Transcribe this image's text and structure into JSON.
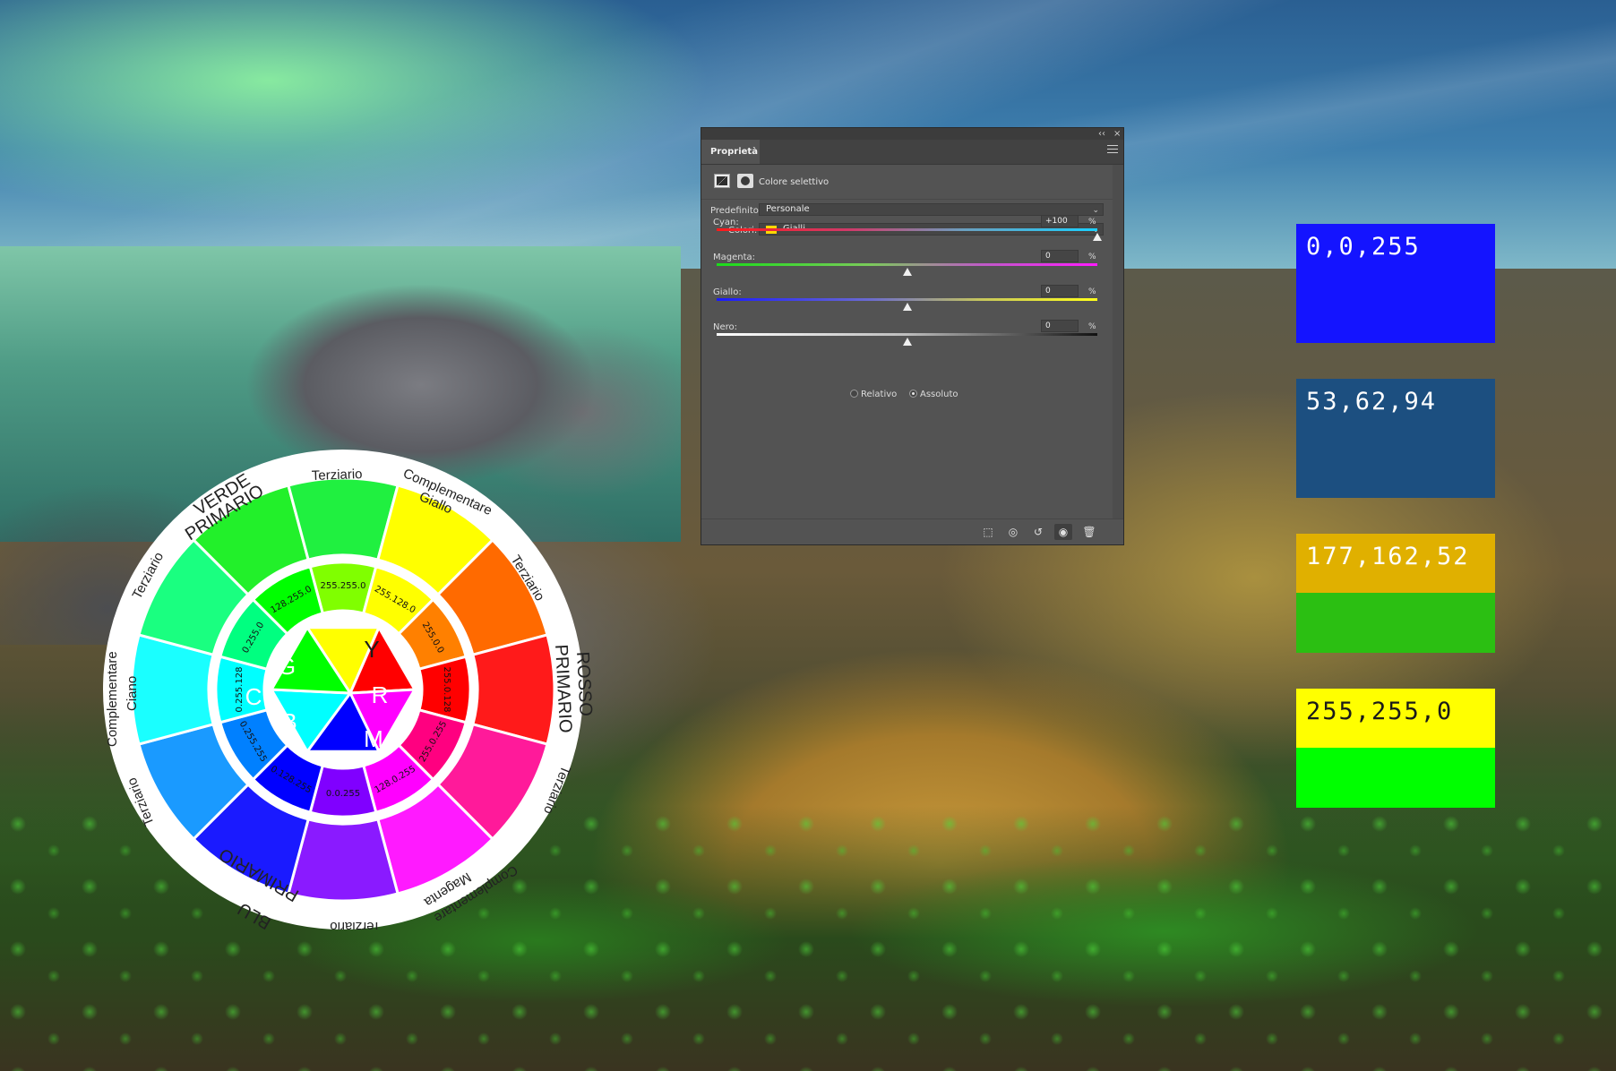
{
  "panel": {
    "tab_label": "Proprietà",
    "collapse_glyph": "‹‹",
    "close_glyph": "×",
    "adjustment_title": "Colore selettivo",
    "preset_label": "Predefinito:",
    "preset_value": "Personale",
    "colors_label": "Colori:",
    "colors_value": "Gialli",
    "colors_chip_color": "#ffd800",
    "sliders": [
      {
        "label": "Cyan:",
        "value": "+100",
        "unit": "%",
        "percent": 100
      },
      {
        "label": "Magenta:",
        "value": "0",
        "unit": "%",
        "percent": 0
      },
      {
        "label": "Giallo:",
        "value": "0",
        "unit": "%",
        "percent": 0
      },
      {
        "label": "Nero:",
        "value": "0",
        "unit": "%",
        "percent": 0
      }
    ],
    "method": {
      "relative_label": "Relativo",
      "absolute_label": "Assoluto",
      "selected": "Assoluto"
    },
    "footer_icons": [
      "clip-to-layer-icon",
      "view-previous-state-icon",
      "reset-icon",
      "visibility-eye-icon",
      "trash-icon"
    ]
  },
  "wheel": {
    "outer_labels": {
      "verde": "VERDE",
      "verde_primario": "PRIMARIO",
      "terziario_top": "Terziario",
      "compl_giallo_1": "Complementare",
      "compl_giallo_2": "Giallo",
      "terziario_right_top": "Terziario",
      "rosso": "ROSSO",
      "rosso_primario": "PRIMARIO",
      "terziario_right_bottom": "Terziario",
      "compl_magenta_1": "Complementare",
      "compl_magenta_2": "Magenta",
      "terziario_bottom": "Terziario",
      "blu": "BLU",
      "blu_primario": "PRIMARIO",
      "terziario_left_bottom": "Terziario",
      "compl_ciano_1": "Complementare",
      "compl_ciano_2": "Ciano",
      "terziario_left_top": "Terziario"
    },
    "inner_values": [
      "128.255.0",
      "255.255.0",
      "255.128.0",
      "255.0.0",
      "255.0.128",
      "255.0.255",
      "128.0.255",
      "0.0.255",
      "0.128.255",
      "0.255.255",
      "0.255.128",
      "0.255.0"
    ],
    "center_letters": {
      "g": "G",
      "y": "Y",
      "r": "R",
      "m": "M",
      "b": "B",
      "c": "C"
    }
  },
  "swatches": [
    {
      "label": "0,0,255",
      "top_color": "#1414ff",
      "bottom_color": "#1414ff",
      "text_color": "#ffffff"
    },
    {
      "label": "53,62,94",
      "top_color": "#1c4f80",
      "bottom_color": "#1c4f80",
      "text_color": "#ffffff"
    },
    {
      "label": "177,162,52",
      "top_color": "#e0b000",
      "bottom_color": "#2bbf12",
      "text_color": "#ffffff"
    },
    {
      "label": "255,255,0",
      "top_color": "#ffff00",
      "bottom_color": "#00ff00",
      "text_color": "#1a1a1a"
    }
  ]
}
